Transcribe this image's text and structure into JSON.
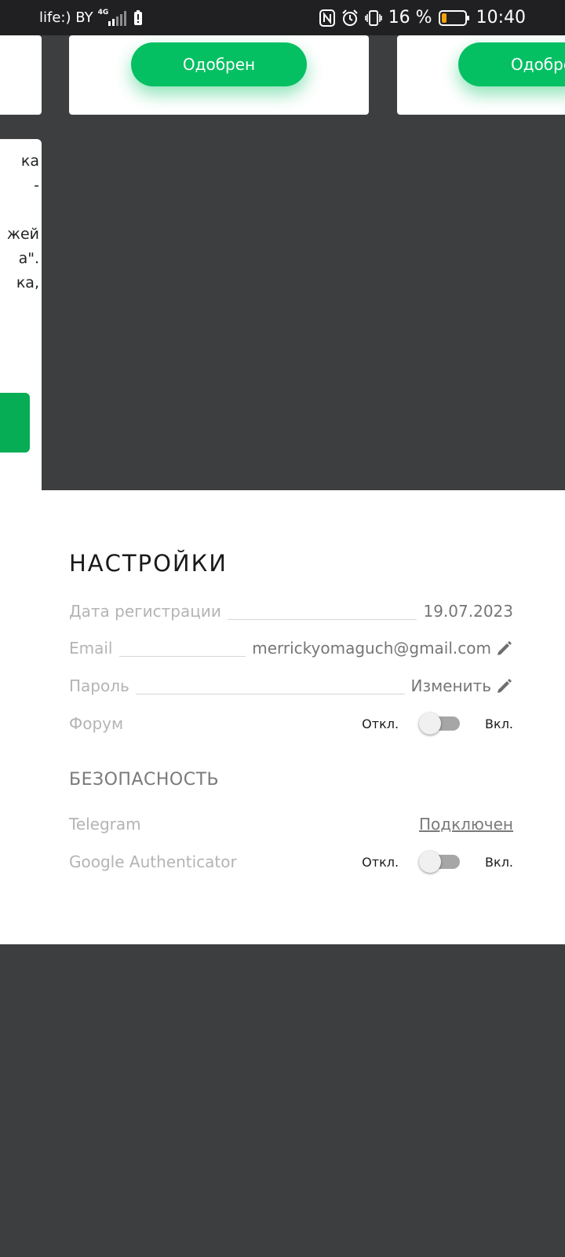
{
  "status_bar": {
    "carrier": "life:) BY",
    "network_type": "4G",
    "battery_percent": "16 %",
    "time": "10:40",
    "icons": [
      "signal-icon",
      "battery-alert-icon",
      "nfc-icon",
      "alarm-icon",
      "vibrate-icon",
      "battery-icon"
    ]
  },
  "cards": {
    "approve_label": "Одобрен",
    "partial_text_lines": [
      "ка",
      "-",
      "",
      "жей",
      "а\".",
      "ка,"
    ]
  },
  "settings": {
    "title": "НАСТРОЙКИ",
    "registration": {
      "label": "Дата регистрации",
      "value": "19.07.2023"
    },
    "email": {
      "label": "Email",
      "value": "merrickyomaguch@gmail.com"
    },
    "password": {
      "label": "Пароль",
      "value": "Изменить"
    },
    "forum": {
      "label": "Форум",
      "off": "Откл.",
      "on": "Вкл.",
      "enabled": false
    }
  },
  "security": {
    "title": "БЕЗОПАСНОСТЬ",
    "telegram": {
      "label": "Telegram",
      "value": "Подключен"
    },
    "google_auth": {
      "label": "Google Authenticator",
      "off": "Откл.",
      "on": "Вкл.",
      "enabled": false
    }
  },
  "colors": {
    "accent_green": "#05c063",
    "background_dark": "#3d3e40",
    "panel_white": "#ffffff",
    "battery_low": "#f2a20c"
  }
}
